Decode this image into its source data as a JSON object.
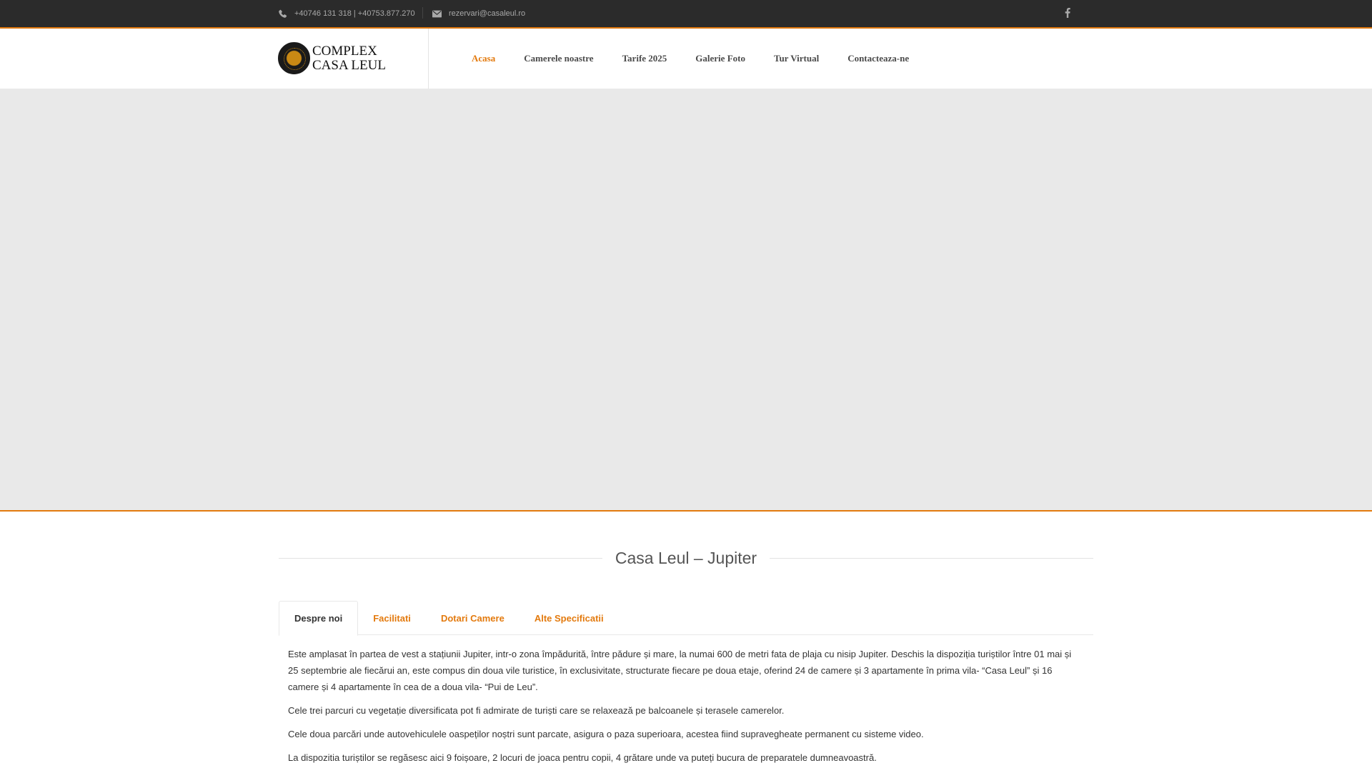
{
  "topbar": {
    "phone": "+40746 131 318 | +40753.877.270",
    "email": "rezervari@casaleul.ro",
    "social_icon": "facebook-icon"
  },
  "header": {
    "logo_line1": "COMPLEX",
    "logo_line2": "CASA LEUL",
    "nav": [
      {
        "label": "Acasa",
        "active": true
      },
      {
        "label": "Camerele noastre",
        "active": false
      },
      {
        "label": "Tarife 2025",
        "active": false
      },
      {
        "label": "Galerie Foto",
        "active": false
      },
      {
        "label": "Tur Virtual",
        "active": false
      },
      {
        "label": "Contacteaza-ne",
        "active": false
      }
    ]
  },
  "colors": {
    "accent": "#e37a0e",
    "topbar_bg": "#2b2b2b",
    "hero_bg": "#e9e9e9"
  },
  "main": {
    "title": "Casa Leul – Jupiter",
    "tabs": [
      {
        "label": "Despre noi",
        "active": true
      },
      {
        "label": "Facilitati",
        "active": false
      },
      {
        "label": "Dotari Camere",
        "active": false
      },
      {
        "label": "Alte Specificatii",
        "active": false
      }
    ],
    "paragraphs": [
      "Este amplasat în partea de vest a stațiunii Jupiter, intr-o zona împădurită, între pădure și mare, la numai 600 de metri fata de plaja cu nisip Jupiter. Deschis la dispoziția turiștilor între 01 mai și 25 septembrie ale fiecărui an, este compus din doua vile turistice, în exclusivitate, structurate fiecare pe doua etaje, oferind 24 de camere și 3 apartamente în prima vila- “Casa Leul” și 16 camere și 4 apartamente în cea de a doua vila- “Pui de Leu”.",
      "Cele trei parcuri cu vegetație diversificata pot fi admirate de turiști care se relaxează pe balcoanele și terasele camerelor.",
      "Cele doua parcări unde autovehiculele oaspeților noștri sunt parcate, asigura o paza superioara, acestea fiind supravegheate permanent cu sisteme video.",
      "La dispozitia turiștilor se regăsesc aici 9 foișoare, 2 locuri de joaca pentru copii, 4 grătare unde va puteți bucura de preparatele dumneavoastră."
    ]
  }
}
